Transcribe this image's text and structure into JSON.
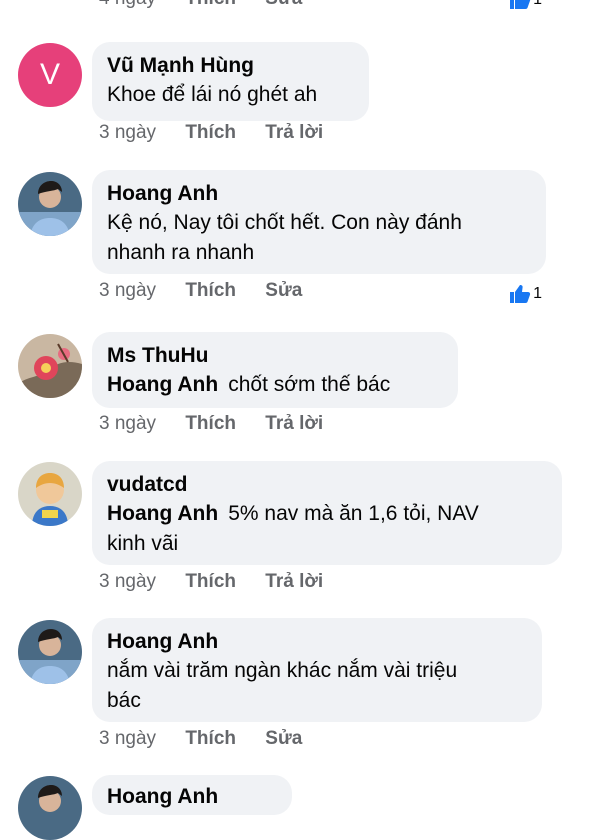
{
  "top_partial": {
    "time": "4 ngày",
    "like": "Thích",
    "edit": "Sửa",
    "reaction_count": "1"
  },
  "comments": [
    {
      "avatar_letter": "V",
      "name": "Vũ Mạnh Hùng",
      "mention": "",
      "text": "Khoe để lái nó ghét ah",
      "time": "3 ngày",
      "like": "Thích",
      "action2": "Trả lời",
      "reaction_count": ""
    },
    {
      "name": "Hoang Anh",
      "mention": "",
      "text_line1": "Kệ nó, Nay tôi chốt hết. Con này đánh",
      "text_line2": "nhanh ra nhanh",
      "time": "3 ngày",
      "like": "Thích",
      "action2": "Sửa",
      "reaction_count": "1"
    },
    {
      "name": "Ms ThuHu",
      "mention": "Hoang Anh",
      "text": "chốt sớm thế bác",
      "time": "3 ngày",
      "like": "Thích",
      "action2": "Trả lời"
    },
    {
      "name": "vudatcd",
      "mention": "Hoang Anh",
      "text_line1": "5% nav mà ăn 1,6 tỏi, NAV",
      "text_line2": "kinh vãi",
      "time": "3 ngày",
      "like": "Thích",
      "action2": "Trả lời"
    },
    {
      "name": "Hoang Anh",
      "text_line1": "nắm vài trăm ngàn khác nắm vài triệu",
      "text_line2": "bác",
      "time": "3 ngày",
      "like": "Thích",
      "action2": "Sửa"
    },
    {
      "name": "Hoang Anh"
    }
  ],
  "colors": {
    "avatar_v": "#e6407a",
    "bubble": "#f0f2f5",
    "meta": "#65676b",
    "like_blue": "#1877f2"
  },
  "icons": {
    "like": "thumbs-up-icon"
  }
}
